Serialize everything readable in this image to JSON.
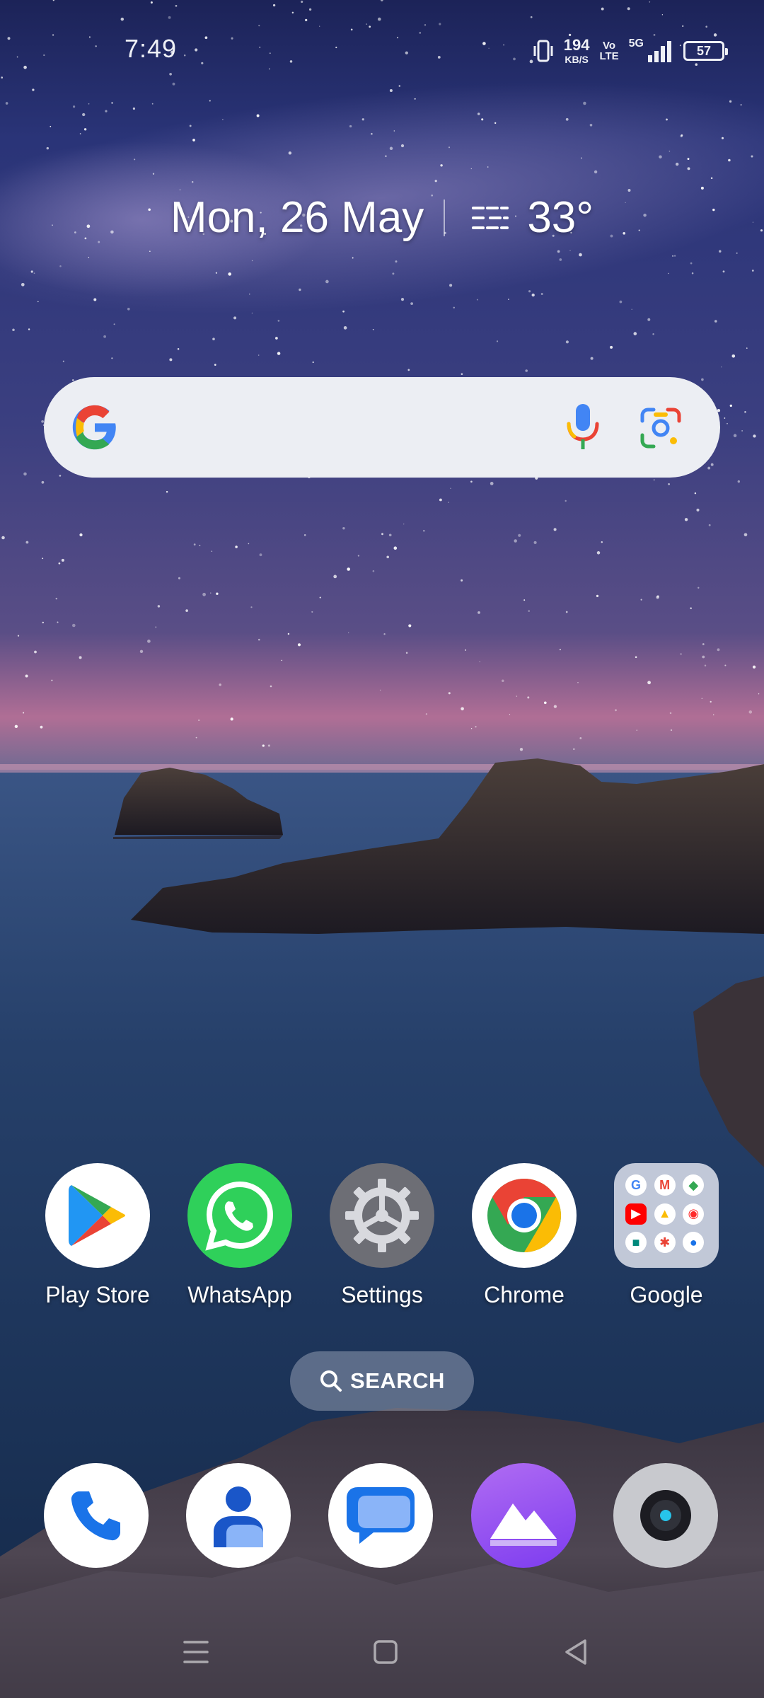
{
  "status_bar": {
    "time": "7:49",
    "speed_value": "194",
    "speed_unit": "KB/S",
    "volte_top": "Vo",
    "volte_bottom": "LTE",
    "network": "5G",
    "battery": "57",
    "icons": [
      "vibrate-icon",
      "signal-icon",
      "battery-icon"
    ]
  },
  "glance": {
    "date": "Mon, 26 May",
    "weather_icon": "haze-icon",
    "temperature": "33°"
  },
  "search_widget": {
    "icons": [
      "google-logo-icon",
      "mic-icon",
      "lens-icon"
    ]
  },
  "home_apps": [
    {
      "label": "Play Store",
      "icon": "play-store-icon"
    },
    {
      "label": "WhatsApp",
      "icon": "whatsapp-icon"
    },
    {
      "label": "Settings",
      "icon": "settings-icon"
    },
    {
      "label": "Chrome",
      "icon": "chrome-icon"
    },
    {
      "label": "Google",
      "icon": "google-folder-icon"
    }
  ],
  "google_folder": {
    "apps": [
      "Google",
      "Gmail",
      "Maps",
      "YouTube",
      "Drive",
      "YT Music",
      "Meet",
      "Photos",
      "Duo"
    ]
  },
  "search_button": {
    "label": "SEARCH"
  },
  "dock": [
    "phone-icon",
    "contacts-icon",
    "messages-icon",
    "gallery-icon",
    "camera-icon"
  ],
  "nav_bar": [
    "recents-icon",
    "home-icon",
    "back-icon"
  ],
  "colors": {
    "sky_top": "#1e2a66",
    "horizon_pink": "#c86f9a",
    "sea": "#24406a",
    "search_bg": "#eceef3"
  }
}
